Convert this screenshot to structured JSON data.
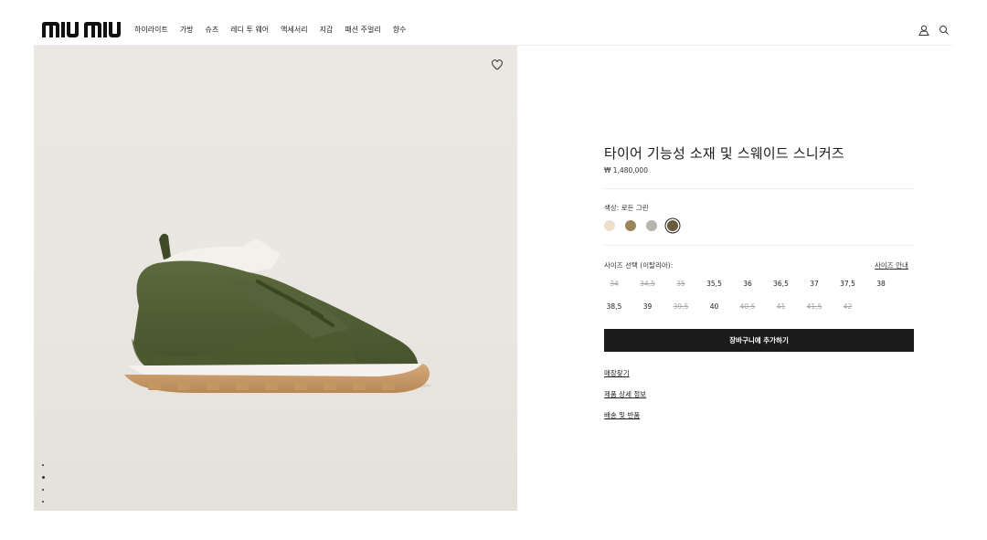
{
  "header": {
    "logo": "ՈՈIU ՈՈIU",
    "nav": [
      "하이라이트",
      "가방",
      "슈즈",
      "레디 투 웨어",
      "액세서리",
      "지갑",
      "패션 주얼리",
      "향수"
    ]
  },
  "product": {
    "title": "타이어 기능성 소재 및 스웨이드 스니커즈",
    "price": "₩ 1,480,000",
    "color_label": "색상: 로든 그린",
    "colors": [
      "#ecdfcc",
      "#9c855a",
      "#b7b4ae",
      "#6b5a42"
    ],
    "selected_color_index": 3,
    "size_label": "사이즈 선택 (이탈리아):",
    "size_guide": "사이즈 안내",
    "sizes": [
      {
        "label": "34",
        "available": false
      },
      {
        "label": "34,5",
        "available": false
      },
      {
        "label": "35",
        "available": false
      },
      {
        "label": "35,5",
        "available": true
      },
      {
        "label": "36",
        "available": true
      },
      {
        "label": "36,5",
        "available": true
      },
      {
        "label": "37",
        "available": true
      },
      {
        "label": "37,5",
        "available": true
      },
      {
        "label": "38",
        "available": true
      },
      {
        "label": "38,5",
        "available": true
      },
      {
        "label": "39",
        "available": true
      },
      {
        "label": "39,5",
        "available": false
      },
      {
        "label": "40",
        "available": true
      },
      {
        "label": "40,5",
        "available": false
      },
      {
        "label": "41",
        "available": false
      },
      {
        "label": "41,5",
        "available": false
      },
      {
        "label": "42",
        "available": false
      }
    ],
    "add_to_cart": "장바구니에 추가하기",
    "links": [
      "매장찾기",
      "제품 상세 정보",
      "배송 및 반품"
    ]
  },
  "gallery": {
    "dots": 4,
    "active_dot": 1
  }
}
